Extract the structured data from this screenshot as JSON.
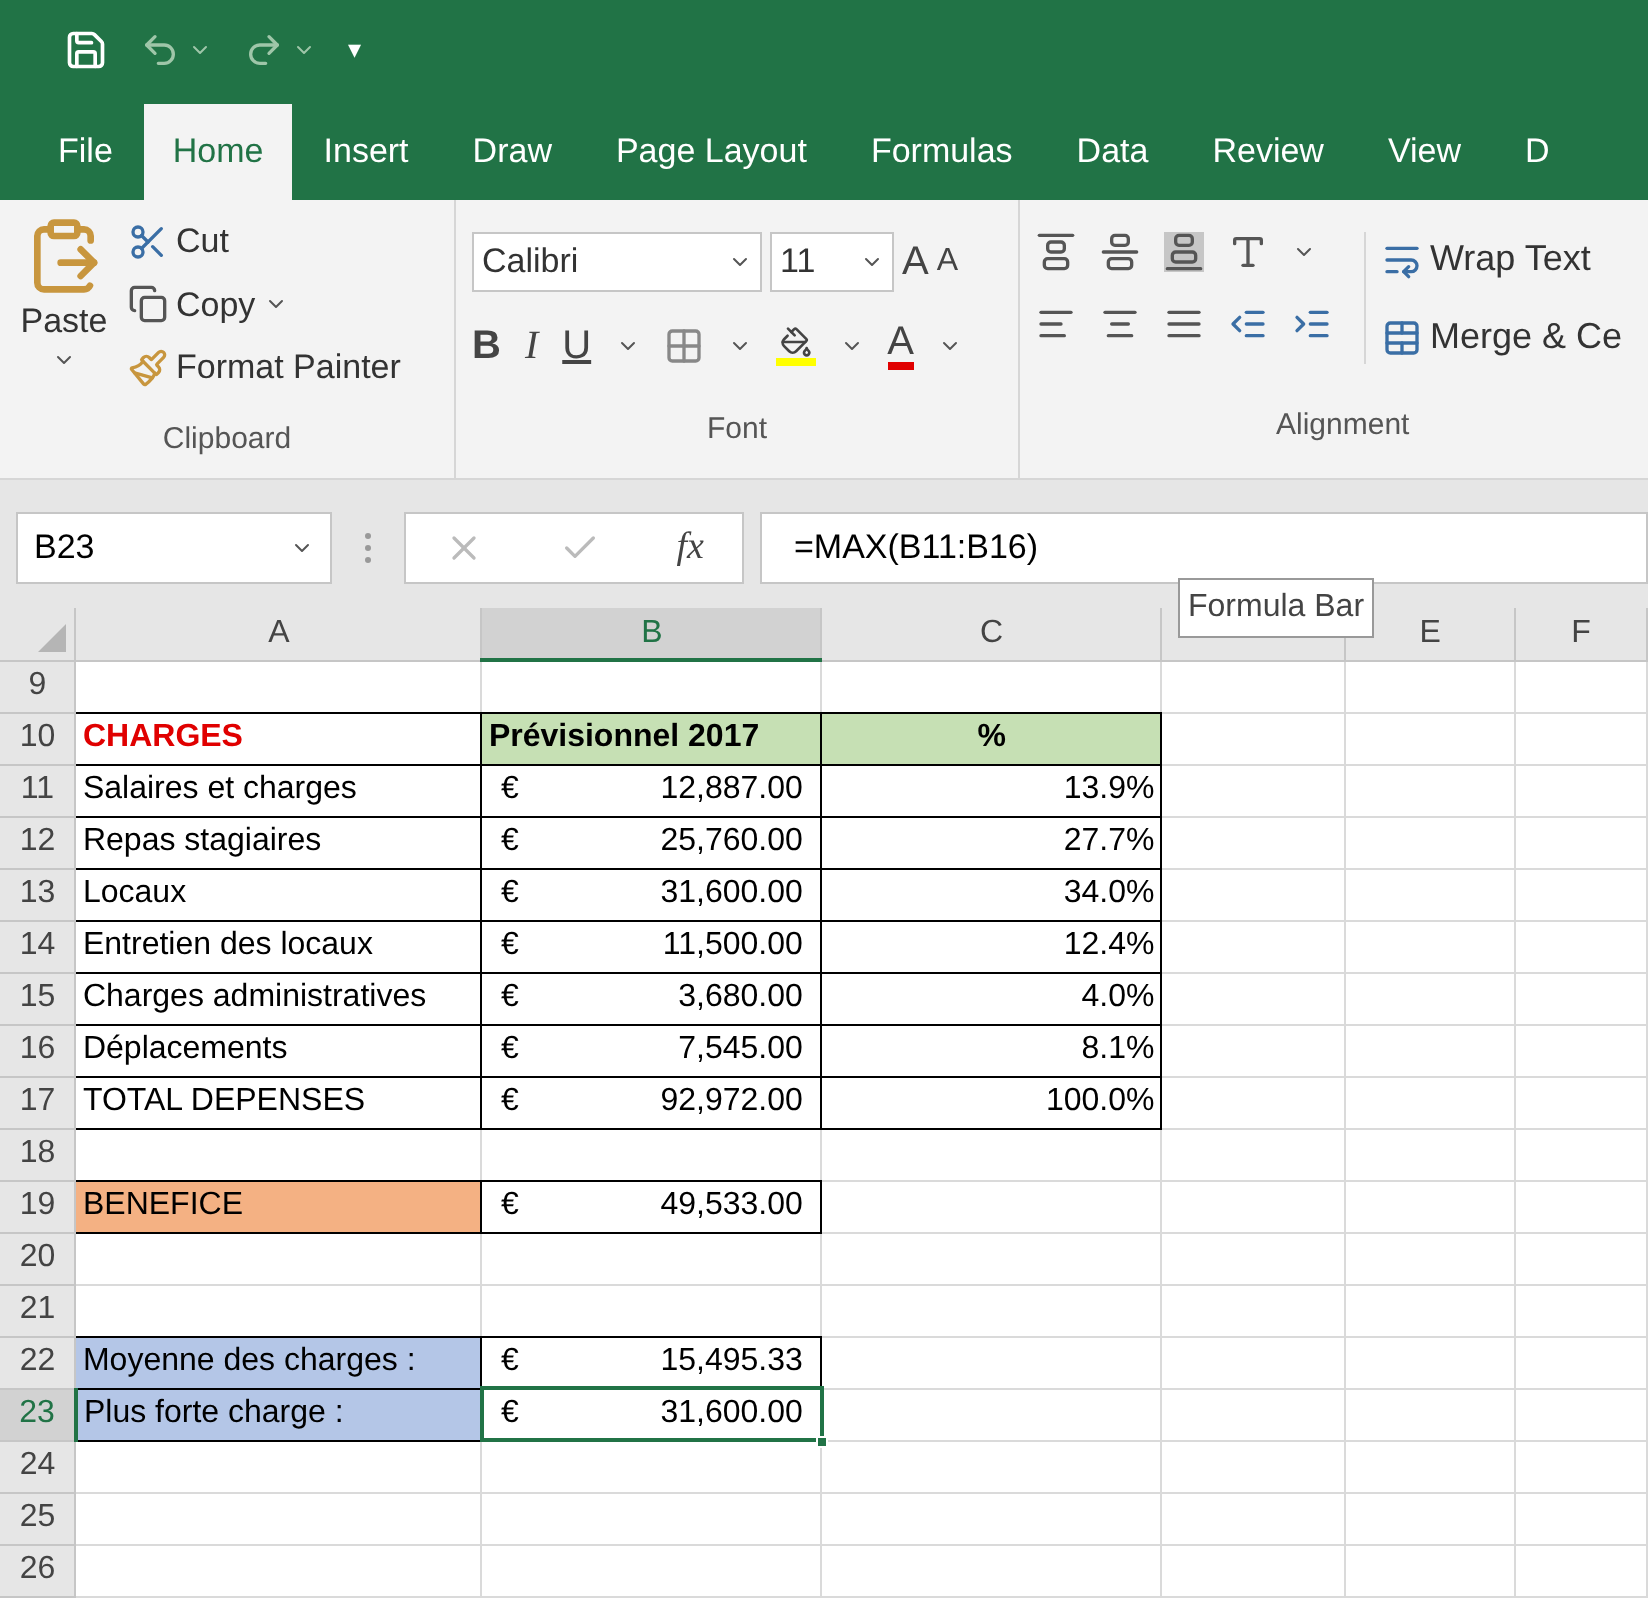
{
  "quick_access": {
    "customize": "▾"
  },
  "tabs": [
    {
      "label": "File",
      "selected": false
    },
    {
      "label": "Home",
      "selected": true
    },
    {
      "label": "Insert",
      "selected": false
    },
    {
      "label": "Draw",
      "selected": false
    },
    {
      "label": "Page Layout",
      "selected": false
    },
    {
      "label": "Formulas",
      "selected": false
    },
    {
      "label": "Data",
      "selected": false
    },
    {
      "label": "Review",
      "selected": false
    },
    {
      "label": "View",
      "selected": false
    },
    {
      "label": "D",
      "selected": false
    }
  ],
  "clipboard": {
    "paste": "Paste",
    "cut": "Cut",
    "copy": "Copy",
    "format_painter": "Format Painter",
    "group_label": "Clipboard"
  },
  "font": {
    "name": "Calibri",
    "size": "11",
    "grow": "A",
    "shrink": "A",
    "bold": "B",
    "italic": "I",
    "underline": "U",
    "font_color": "A",
    "group_label": "Font"
  },
  "alignment": {
    "wrap_text": "Wrap Text",
    "merge": "Merge & Ce",
    "group_label": "Alignment"
  },
  "formula_bar": {
    "name_box": "B23",
    "function_symbol": "fx",
    "formula": "=MAX(B11:B16)",
    "tooltip": "Formula Bar"
  },
  "columns": [
    {
      "label": "A",
      "selected": false
    },
    {
      "label": "B",
      "selected": true
    },
    {
      "label": "C",
      "selected": false
    },
    {
      "selected": false
    },
    {
      "label": "E",
      "selected": false
    },
    {
      "label": "F",
      "selected": false
    }
  ],
  "rows": [
    {
      "number": "9",
      "selected": false,
      "cells": []
    },
    {
      "number": "10",
      "selected": false,
      "cells": [
        {
          "kind": "title",
          "text": "CHARGES"
        },
        {
          "kind": "header",
          "text": "Prévisionnel 2017"
        },
        {
          "kind": "header",
          "text": "%"
        }
      ]
    },
    {
      "number": "11",
      "selected": false,
      "cells": [
        {
          "kind": "label",
          "text": "Salaires et charges"
        },
        {
          "kind": "currency",
          "symbol": "€",
          "text": "12,887.00"
        },
        {
          "kind": "number",
          "text": "13.9%"
        }
      ]
    },
    {
      "number": "12",
      "selected": false,
      "cells": [
        {
          "kind": "label",
          "text": "Repas stagiaires"
        },
        {
          "kind": "currency",
          "symbol": "€",
          "text": "25,760.00"
        },
        {
          "kind": "number",
          "text": "27.7%"
        }
      ]
    },
    {
      "number": "13",
      "selected": false,
      "cells": [
        {
          "kind": "label",
          "text": "Locaux"
        },
        {
          "kind": "currency",
          "symbol": "€",
          "text": "31,600.00"
        },
        {
          "kind": "number",
          "text": "34.0%"
        }
      ]
    },
    {
      "number": "14",
      "selected": false,
      "cells": [
        {
          "kind": "label",
          "text": "Entretien des locaux"
        },
        {
          "kind": "currency",
          "symbol": "€",
          "text": "11,500.00"
        },
        {
          "kind": "number",
          "text": "12.4%"
        }
      ]
    },
    {
      "number": "15",
      "selected": false,
      "cells": [
        {
          "kind": "label",
          "text": "Charges administratives"
        },
        {
          "kind": "currency",
          "symbol": "€",
          "text": "3,680.00"
        },
        {
          "kind": "number",
          "text": "4.0%"
        }
      ]
    },
    {
      "number": "16",
      "selected": false,
      "cells": [
        {
          "kind": "label",
          "text": "Déplacements"
        },
        {
          "kind": "currency",
          "symbol": "€",
          "text": "7,545.00"
        },
        {
          "kind": "number",
          "text": "8.1%"
        }
      ]
    },
    {
      "number": "17",
      "selected": false,
      "cells": [
        {
          "kind": "label",
          "text": "TOTAL DEPENSES"
        },
        {
          "kind": "currency",
          "symbol": "€",
          "text": "92,972.00"
        },
        {
          "kind": "number",
          "text": "100.0%"
        }
      ]
    },
    {
      "number": "18",
      "selected": false,
      "cells": []
    },
    {
      "number": "19",
      "selected": false,
      "cells": [
        {
          "kind": "result",
          "text": "BENEFICE"
        },
        {
          "kind": "currency",
          "symbol": "€",
          "text": "49,533.00"
        }
      ]
    },
    {
      "number": "20",
      "selected": false,
      "cells": []
    },
    {
      "number": "21",
      "selected": false,
      "cells": []
    },
    {
      "number": "22",
      "selected": false,
      "cells": [
        {
          "kind": "summary",
          "text": "Moyenne des charges :"
        },
        {
          "kind": "currency",
          "symbol": "€",
          "text": "15,495.33"
        }
      ]
    },
    {
      "number": "23",
      "selected": true,
      "cells": [
        {
          "kind": "summary",
          "text": "Plus forte charge :"
        },
        {
          "kind": "currency",
          "symbol": "€",
          "text": "31,600.00",
          "selected": true
        }
      ]
    },
    {
      "number": "24",
      "selected": false,
      "cells": []
    },
    {
      "number": "25",
      "selected": false,
      "cells": []
    },
    {
      "number": "26",
      "selected": false,
      "cells": []
    }
  ]
}
